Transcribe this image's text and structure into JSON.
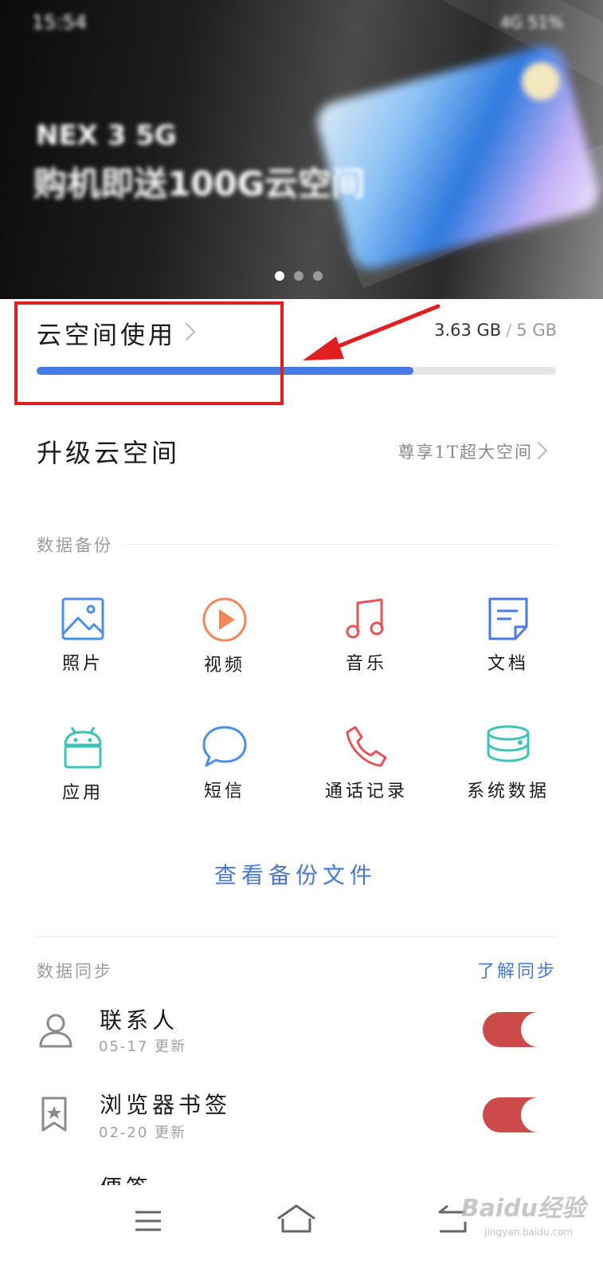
{
  "banner": {
    "status_time": "15:54",
    "status_right": "4G 51%",
    "brand": "NEX 3 5G",
    "promo": "购机即送100G云空间",
    "slide_count": 3,
    "active_slide": 0
  },
  "storage": {
    "title": "云空间使用",
    "used": "3.63 GB",
    "separator": "/",
    "total": "5 GB",
    "used_fraction": 0.726,
    "bar_color": "#4a78e6"
  },
  "upgrade": {
    "title": "升级云空间",
    "hint": "尊享1T超大空间"
  },
  "backup": {
    "section_label": "数据备份",
    "items": [
      {
        "label": "照片",
        "icon": "photo-icon",
        "color": "#4a8fe6"
      },
      {
        "label": "视频",
        "icon": "video-play-icon",
        "color": "#f0875a"
      },
      {
        "label": "音乐",
        "icon": "music-note-icon",
        "color": "#e8525a"
      },
      {
        "label": "文档",
        "icon": "document-icon",
        "color": "#4a78e6"
      },
      {
        "label": "应用",
        "icon": "android-app-icon",
        "color": "#3cc4b8"
      },
      {
        "label": "短信",
        "icon": "message-bubble-icon",
        "color": "#4a8fe6"
      },
      {
        "label": "通话记录",
        "icon": "phone-icon",
        "color": "#e8525a"
      },
      {
        "label": "系统数据",
        "icon": "database-icon",
        "color": "#3cc4b8"
      }
    ],
    "view_files": "查看备份文件"
  },
  "sync": {
    "section_label": "数据同步",
    "help_link": "了解同步",
    "items": [
      {
        "name": "联系人",
        "date": "05-17",
        "update_label": "更新",
        "enabled": true,
        "icon": "contact-icon"
      },
      {
        "name": "浏览器书签",
        "date": "02-20",
        "update_label": "更新",
        "enabled": true,
        "icon": "bookmark-icon"
      }
    ],
    "partial_item": "便签",
    "toggle_color": "#cc4a4a"
  },
  "navbar": {
    "items": [
      "menu-icon",
      "home-icon",
      "back-icon"
    ]
  },
  "watermark": {
    "text": "Baidu经验",
    "sub": "jingyan.baidu.com"
  },
  "annotation": {
    "color": "#e02020"
  }
}
